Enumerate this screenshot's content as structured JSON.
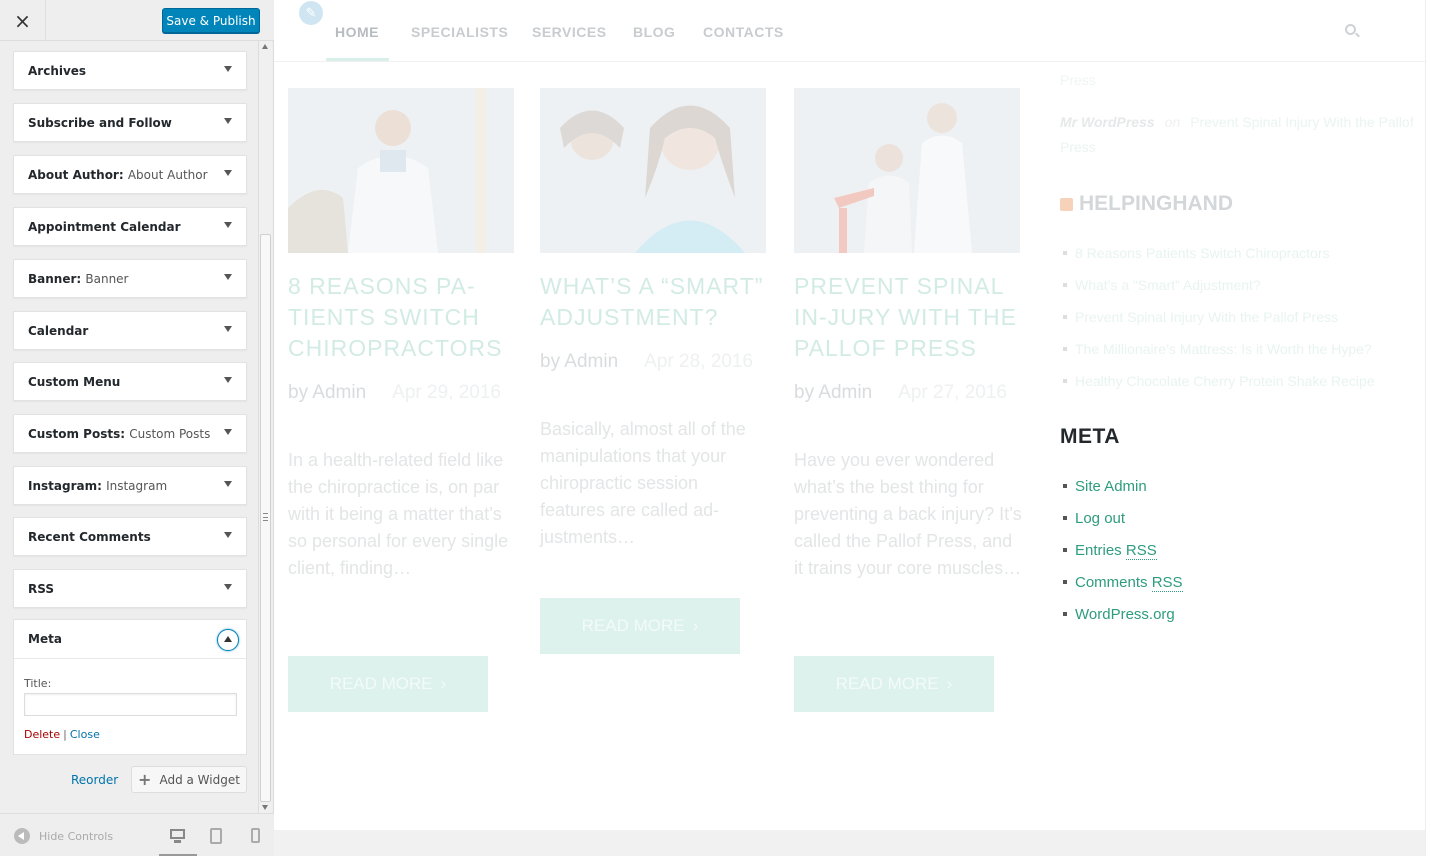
{
  "customizer": {
    "close_label": "×",
    "save_label": "Save & Publish",
    "widgets": [
      {
        "name": "Archives",
        "subtitle": ""
      },
      {
        "name": "Subscribe and Follow",
        "subtitle": ""
      },
      {
        "name": "About Author",
        "subtitle": "About Author"
      },
      {
        "name": "Appointment Calendar",
        "subtitle": ""
      },
      {
        "name": "Banner",
        "subtitle": "Banner"
      },
      {
        "name": "Calendar",
        "subtitle": ""
      },
      {
        "name": "Custom Menu",
        "subtitle": ""
      },
      {
        "name": "Custom Posts",
        "subtitle": "Custom Posts"
      },
      {
        "name": "Instagram",
        "subtitle": "Instagram"
      },
      {
        "name": "Recent Comments",
        "subtitle": ""
      },
      {
        "name": "RSS",
        "subtitle": ""
      }
    ],
    "meta_widget": {
      "name": "Meta",
      "title_label": "Title:",
      "title_value": "",
      "delete_label": "Delete",
      "separator": "|",
      "close_label": "Close"
    },
    "reorder_label": "Reorder",
    "add_widget_label": "Add a Widget",
    "hide_controls_label": "Hide Controls",
    "devices": [
      "desktop",
      "tablet",
      "mobile"
    ],
    "active_device": "desktop"
  },
  "site": {
    "nav": [
      "HOME",
      "SPECIALISTS",
      "SERVICES",
      "BLOG",
      "CONTACTS"
    ],
    "active_nav": "HOME",
    "posts": [
      {
        "title": "8 REASONS PA-TIENTS SWITCH CHIROPRACTORS",
        "author": "by Admin",
        "date": "Apr 29, 2016",
        "excerpt": "In a health-related field like the chiropractice is, on par with it being a matter that’s so personal for every single client, finding…",
        "read_more": "READ MORE"
      },
      {
        "title": "WHAT’S A “SMART” ADJUSTMENT?",
        "author": "by Admin",
        "date": "Apr 28, 2016",
        "excerpt": "Basically, almost all of the manipulations that your chiropractic session features are called ad-justments…",
        "read_more": "READ MORE"
      },
      {
        "title": "PREVENT SPINAL IN-JURY WITH THE PALLOF PRESS",
        "author": "by Admin",
        "date": "Apr 27, 2016",
        "excerpt": "Have you ever wondered what’s the best thing for preventing a back injury? It’s called the Pallof Press, and it trains your core muscles…",
        "read_more": "READ MORE"
      }
    ],
    "sidebar": {
      "recent_comment_top": "Press",
      "recent_comment": {
        "author": "Mr WordPress",
        "on": "on",
        "post": "Prevent Spinal Injury With the Pallof Press"
      },
      "helping_title": "HELPINGHAND",
      "helping_items": [
        "8 Reasons Patients Switch Chiropractors",
        "What’s a “Smart” Adjustment?",
        "Prevent Spinal Injury With the Pallof Press",
        "The Millionaire’s Mattress: Is it Worth the Hype?",
        "Healthy Chocolate Cherry Protein Shake Recipe"
      ],
      "meta_title": "META",
      "meta_items": {
        "site_admin": "Site Admin",
        "log_out": "Log out",
        "entries": "Entries",
        "entries_rss": "RSS",
        "comments": "Comments",
        "comments_rss": "RSS",
        "wordpress_org": "WordPress.org"
      }
    }
  },
  "colors": {
    "primary_button": "#0085ba",
    "link": "#0073aa",
    "delete": "#a00",
    "site_accent": "#2e9c7e"
  },
  "icons": [
    "close-icon",
    "chevron-down-icon",
    "chevron-up-icon",
    "plus-icon",
    "hide-controls-icon",
    "desktop-icon",
    "tablet-icon",
    "mobile-icon",
    "edit-pencil-icon",
    "search-icon",
    "rss-icon",
    "chevron-right-icon"
  ]
}
